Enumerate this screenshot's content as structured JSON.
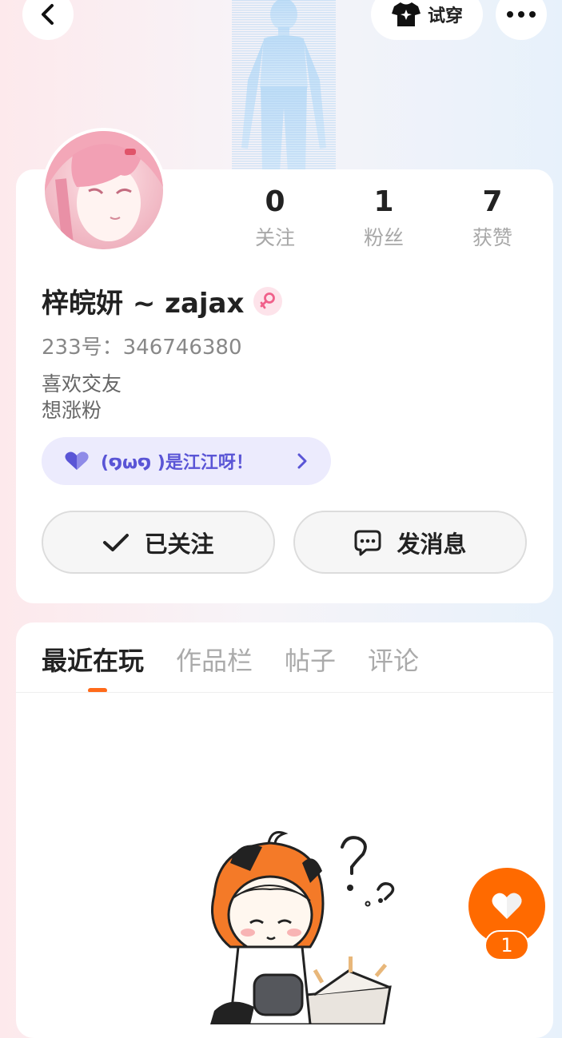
{
  "header": {
    "try_on_label": "试穿"
  },
  "profile": {
    "username": "梓皖妍 ~ zajax",
    "uid_text": "233号：346746380",
    "bio_lines": [
      "喜欢交友",
      "想涨粉"
    ],
    "stats": [
      {
        "value": "0",
        "label": "关注"
      },
      {
        "value": "1",
        "label": "粉丝"
      },
      {
        "value": "7",
        "label": "获赞"
      }
    ],
    "badge_text": "(໑ω໑ )是江江呀！",
    "follow_label": "已关注",
    "message_label": "发消息"
  },
  "tabs": [
    {
      "label": "最近在玩",
      "active": true
    },
    {
      "label": "作品栏",
      "active": false
    },
    {
      "label": "帖子",
      "active": false
    },
    {
      "label": "评论",
      "active": false
    }
  ],
  "like_fab": {
    "count": "1"
  },
  "colors": {
    "accent": "#ff6a00",
    "badge_bg": "#ecebfd",
    "badge_text": "#5a55d6",
    "gender_pink": "#f0608a"
  },
  "icons": [
    "back-icon",
    "tshirt-star-icon",
    "more-icon",
    "female-icon",
    "heart-badge-icon",
    "chevron-right-icon",
    "check-icon",
    "chat-bubble-icon",
    "heart-icon"
  ]
}
